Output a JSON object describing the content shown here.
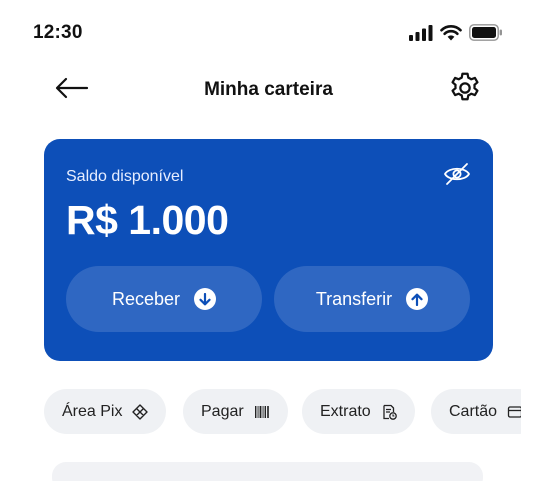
{
  "status_bar": {
    "time": "12:30",
    "icons": [
      "cellular-signal-icon",
      "wifi-icon",
      "battery-icon"
    ]
  },
  "header": {
    "title": "Minha carteira",
    "back_icon": "arrow-left-icon",
    "settings_icon": "gear-icon"
  },
  "balance_card": {
    "label": "Saldo disponível",
    "value": "R$ 1.000",
    "visibility_icon": "eye-off-icon",
    "background_color": "#0d4fb8",
    "actions": [
      {
        "label": "Receber",
        "icon": "arrow-down-circle-icon"
      },
      {
        "label": "Transferir",
        "icon": "arrow-up-circle-icon"
      }
    ]
  },
  "quick_actions": [
    {
      "label": "Área Pix",
      "icon": "pix-icon"
    },
    {
      "label": "Pagar",
      "icon": "barcode-icon"
    },
    {
      "label": "Extrato",
      "icon": "statement-icon"
    },
    {
      "label": "Cartão",
      "icon": "card-icon"
    }
  ]
}
